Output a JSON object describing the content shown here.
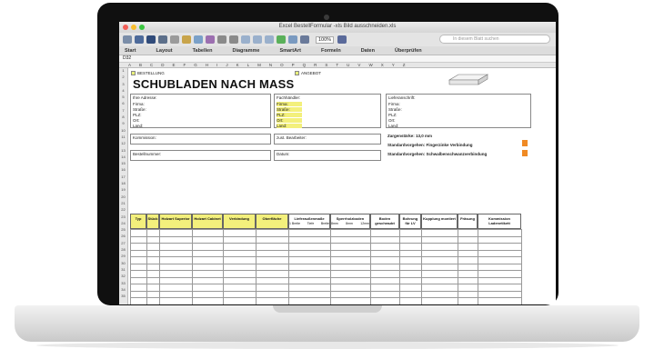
{
  "window": {
    "title": "Excel BestellFormular -xls Bild ausschneiden.xls",
    "zoom": "100%",
    "search_placeholder": "In diesem Blatt suchen"
  },
  "ribbon": {
    "tabs": [
      "Start",
      "Layout",
      "Tabellen",
      "Diagramme",
      "SmartArt",
      "Formeln",
      "Daten",
      "Überprüfen"
    ]
  },
  "formula_bar": {
    "cell_ref": "D32"
  },
  "sheet": {
    "bestellung": "BESTELLUNG",
    "angebot": "ANGEBOT",
    "heading": "SCHUBLADEN NACH MASS",
    "address": {
      "title": "Ihre Adresse:",
      "fields": [
        "Firma:",
        "Straße:",
        "PLZ:",
        "Ort:",
        "Land:"
      ]
    },
    "fachhaendler": {
      "title": "Fachhändler:",
      "fields": [
        "Firma:",
        "Straße:",
        "PLZ:",
        "Ort:",
        "Land:"
      ]
    },
    "lieferanschrift": {
      "title": "Lieferanschrift:",
      "fields": [
        "Firma:",
        "Straße:",
        "PLZ:",
        "Ort:",
        "Land:"
      ]
    },
    "kommission": "Kommission:",
    "bearbeiter": "zust. Bearbeiter:",
    "bestellnummer": "Bestellnummer:",
    "datum": "Datum:",
    "zargenstaerke": "Zargenstärke:  13,0 mm",
    "standard1": "Standardvorgehen: Fingerzinke Verbindung",
    "standard2": "Standardvorgehen: Schwalbenschwanzverbindung",
    "columns": [
      "Typ",
      "Stück",
      "Holzart Superior",
      "Holzart Cabinet",
      "Verbindung",
      "Oberfläche",
      "Lieferaußenmaße",
      "Sperrholzboden",
      "Boden geschraubt",
      "Bohrung für LV",
      "Kupplung montiert",
      "Fräsung",
      "Kommission Ladenetikett"
    ],
    "sub_liefer": [
      "1 Breite",
      "Tiefe",
      "Breite"
    ],
    "sub_sperr": [
      "8mm",
      "8mm",
      "12mm"
    ],
    "row_numbers": [
      "1",
      "2",
      "3",
      "4",
      "5",
      "6",
      "7",
      "8",
      "9",
      "10",
      "11",
      "12",
      "13",
      "14",
      "15",
      "16",
      "17",
      "18",
      "19",
      "20",
      "21",
      "22",
      "23",
      "24",
      "25",
      "26",
      "27",
      "28",
      "29",
      "30",
      "31",
      "32",
      "33",
      "34",
      "35"
    ]
  },
  "colors": {
    "accent_yellow": "#f3f07c",
    "orange": "#f08a24",
    "lid": "#101010"
  }
}
